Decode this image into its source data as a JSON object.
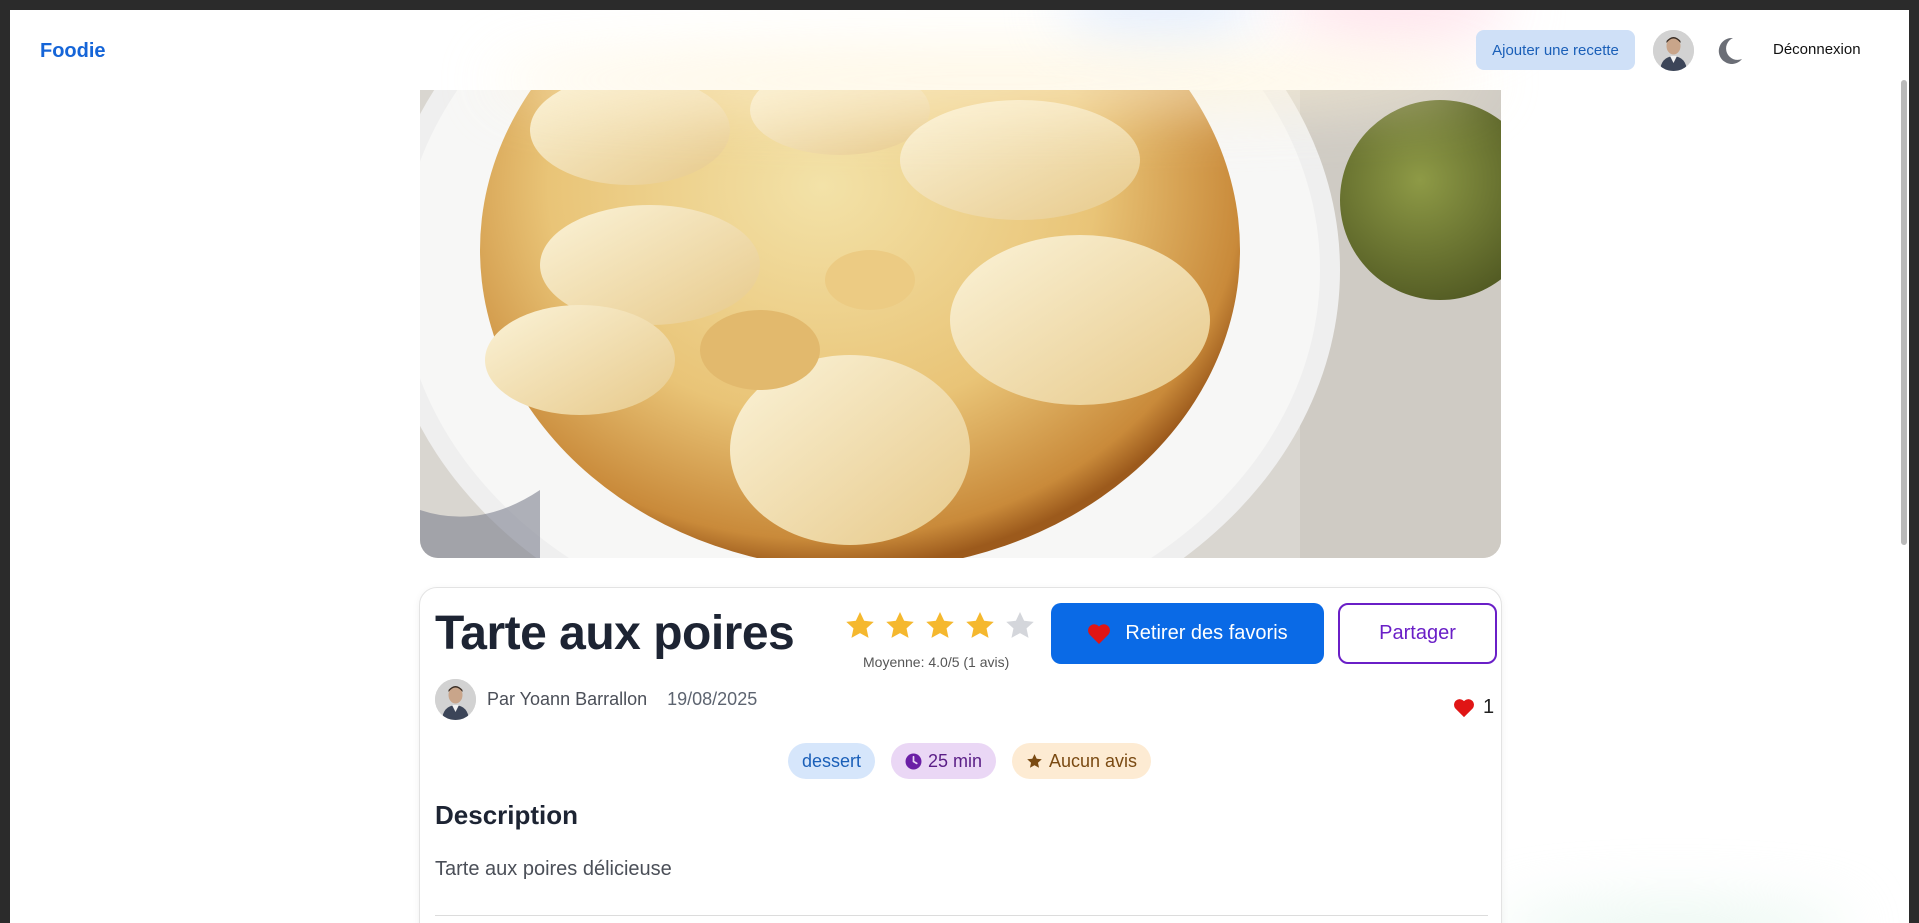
{
  "nav": {
    "brand": "Foodie",
    "add_recipe": "Ajouter une recette",
    "logout": "Déconnexion"
  },
  "recipe": {
    "title": "Tarte aux poires",
    "author": "Par Yoann Barrallon",
    "date": "19/08/2025",
    "rating_stars": 4,
    "rating_max": 5,
    "average": "Moyenne: 4.0/5 (1 avis)",
    "remove_favorite": "Retirer des favoris",
    "share": "Partager",
    "favorites_count": "1",
    "tags": {
      "category": "dessert",
      "time": "25 min",
      "rating": "Aucun avis"
    },
    "description_title": "Description",
    "description": "Tarte aux poires délicieuse"
  },
  "colors": {
    "primary": "#0a6ae6",
    "brand": "#1565d8",
    "star": "#f5b82e",
    "star_empty": "#d4d6db",
    "heart": "#e01515",
    "share": "#6a1fc7"
  },
  "icons": {
    "theme_toggle": "moon-icon",
    "favorite": "heart-icon",
    "time": "clock-icon",
    "rating": "star-icon"
  }
}
